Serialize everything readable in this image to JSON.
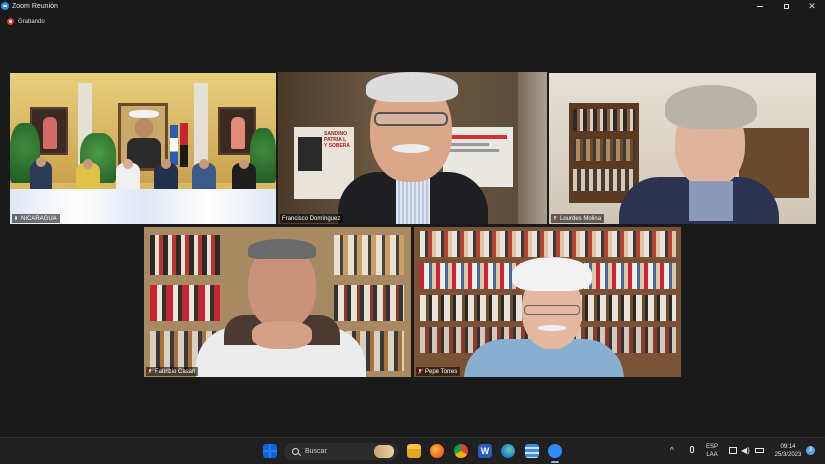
{
  "window": {
    "title": "Zoom Reunión",
    "controls": [
      "minimize",
      "restore",
      "close"
    ]
  },
  "recording": {
    "label": "Grabando"
  },
  "participants": [
    {
      "name": "NICARAGUA",
      "muted": false
    },
    {
      "name": "Francisco Domínguez",
      "muted": false,
      "active_speaker": true
    },
    {
      "name": "Lourdes Molina",
      "muted": true
    },
    {
      "name": "Fabrizio Casari",
      "muted": true
    },
    {
      "name": "Pepe Torres",
      "muted": true
    }
  ],
  "scene_text": {
    "poster_line1": "SANDINO",
    "poster_line2": "PATRIA L",
    "poster_line3": "Y SOBERA"
  },
  "taskbar": {
    "search_placeholder": "Buscar",
    "language_line1": "ESP",
    "language_line2": "LAA",
    "time": "09:14",
    "date": "25/3/2023",
    "notification_count": "3",
    "apps": [
      "windows-start",
      "search",
      "file-explorer",
      "firefox",
      "chrome",
      "word",
      "edge",
      "notepad",
      "zoom"
    ]
  },
  "colors": {
    "active_speaker_border": "#c7dd4e",
    "zoom_blue": "#2d8cff",
    "recording_red": "#d63b2f",
    "background": "#1a1a1a"
  }
}
